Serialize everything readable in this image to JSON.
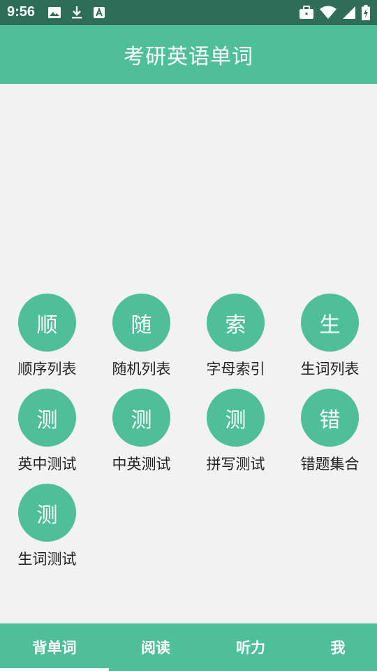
{
  "status_bar": {
    "time": "9:56",
    "left_icons": [
      "image-icon",
      "download-icon",
      "font-icon"
    ],
    "right_icons": [
      "briefcase-icon",
      "wifi-icon",
      "signal-icon",
      "battery-charging-icon"
    ]
  },
  "app_bar": {
    "title": "考研英语单词"
  },
  "grid": {
    "items": [
      {
        "glyph": "顺",
        "label": "顺序列表"
      },
      {
        "glyph": "随",
        "label": "随机列表"
      },
      {
        "glyph": "索",
        "label": "字母索引"
      },
      {
        "glyph": "生",
        "label": "生词列表"
      },
      {
        "glyph": "测",
        "label": "英中测试"
      },
      {
        "glyph": "测",
        "label": "中英测试"
      },
      {
        "glyph": "测",
        "label": "拼写测试"
      },
      {
        "glyph": "错",
        "label": "错题集合"
      },
      {
        "glyph": "测",
        "label": "生词测试"
      }
    ]
  },
  "bottom_nav": {
    "selected_index": 0,
    "tabs": [
      {
        "label": "背单词"
      },
      {
        "label": "阅读"
      },
      {
        "label": "听力"
      },
      {
        "label": "我"
      }
    ]
  },
  "colors": {
    "accent": "#4ebf98",
    "status_bar": "#2e6e59",
    "background": "#f2f2f2"
  }
}
